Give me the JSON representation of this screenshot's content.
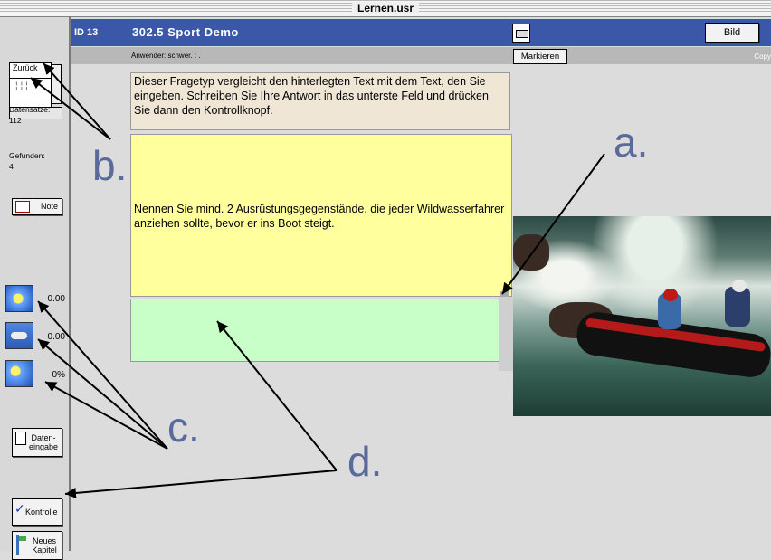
{
  "window": {
    "title": "Lernen.usr"
  },
  "sidebar": {
    "back_label": "Zurück",
    "records_label": "Datensätze:",
    "records_value": "112",
    "found_label": "Gefunden:",
    "found_value": "4",
    "note_label": "Note",
    "scores": [
      {
        "icon": "sun-icon",
        "value": "0.00"
      },
      {
        "icon": "cloud-icon",
        "value": "0.00"
      },
      {
        "icon": "sun-cloud-icon",
        "value": "0%"
      }
    ],
    "data_entry_line1": "Daten-",
    "data_entry_line2": "eingabe",
    "check_label": "Kontrolle",
    "new_chapter_line1": "Neues",
    "new_chapter_line2": "Kapitel"
  },
  "header": {
    "id": "ID 13",
    "title": "302.5 Sport Demo",
    "image_button": "Bild"
  },
  "subbar": {
    "user": "Anwender: schwer. : .",
    "mark_button": "Markieren",
    "copyright": "Copy"
  },
  "content": {
    "instructions": "Dieser Fragetyp vergleicht den hinterlegten Text mit dem Text, den Sie eingeben. Schreiben Sie Ihre Antwort in das unterste Feld und drücken Sie dann den Kontrollknopf.",
    "question": "Nennen Sie mind. 2 Ausrüstungsgegenstände, die jeder Wildwasserfahrer anziehen sollte,  bevor er ins Boot steigt.",
    "answer": ""
  },
  "annotations": {
    "a": "a.",
    "b": "b.",
    "c": "c.",
    "d": "d."
  }
}
